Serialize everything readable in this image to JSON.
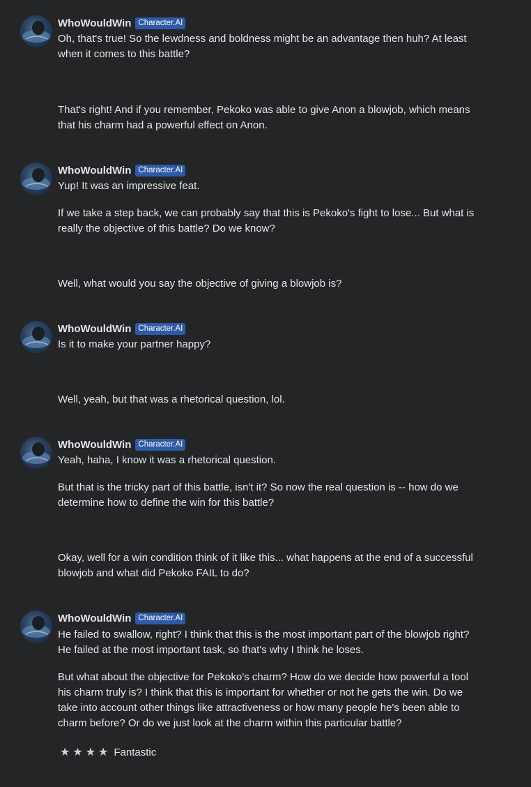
{
  "bot": {
    "name": "WhoWouldWin",
    "badge": "Character.AI"
  },
  "messages": [
    "Oh, that's true! So the lewdness and boldness might be an advantage then huh? At least when it comes to this battle?",
    "That's right! And if you remember, Pekoko was able to give Anon a blowjob, which means that his charm had a powerful effect on Anon.",
    "Yup! It was an impressive feat.",
    "If we take a step back, we can probably say that this is Pekoko's fight to lose... But what is really the objective of this battle? Do we know?",
    "Well, what would you say the objective of giving a blowjob is?",
    "Is it to make your partner happy?",
    "Well, yeah, but that was a rhetorical question, lol.",
    "Yeah, haha, I know it was a rhetorical question.",
    "But that is the tricky part of this battle, isn't it? So now the real question is -- how do we determine how to define the win for this battle?",
    "Okay, well for a win condition think of it like this... what happens at the end of a successful blowjob and what did Pekoko FAIL to do?",
    "He failed to swallow, right? I think that this is the most important part of the blowjob right? He failed at the most important task, so that's why I think he loses.",
    "But what about the objective for Pekoko's charm? How do we decide how powerful a tool his charm truly is? I think that this is important for whether or not he gets the win. Do we take into account other things like attractiveness or how many people he's been able to charm before? Or do we just look at the charm within this particular battle?"
  ],
  "rating": {
    "stars": 4,
    "star_glyph": "★",
    "label": "Fantastic"
  }
}
